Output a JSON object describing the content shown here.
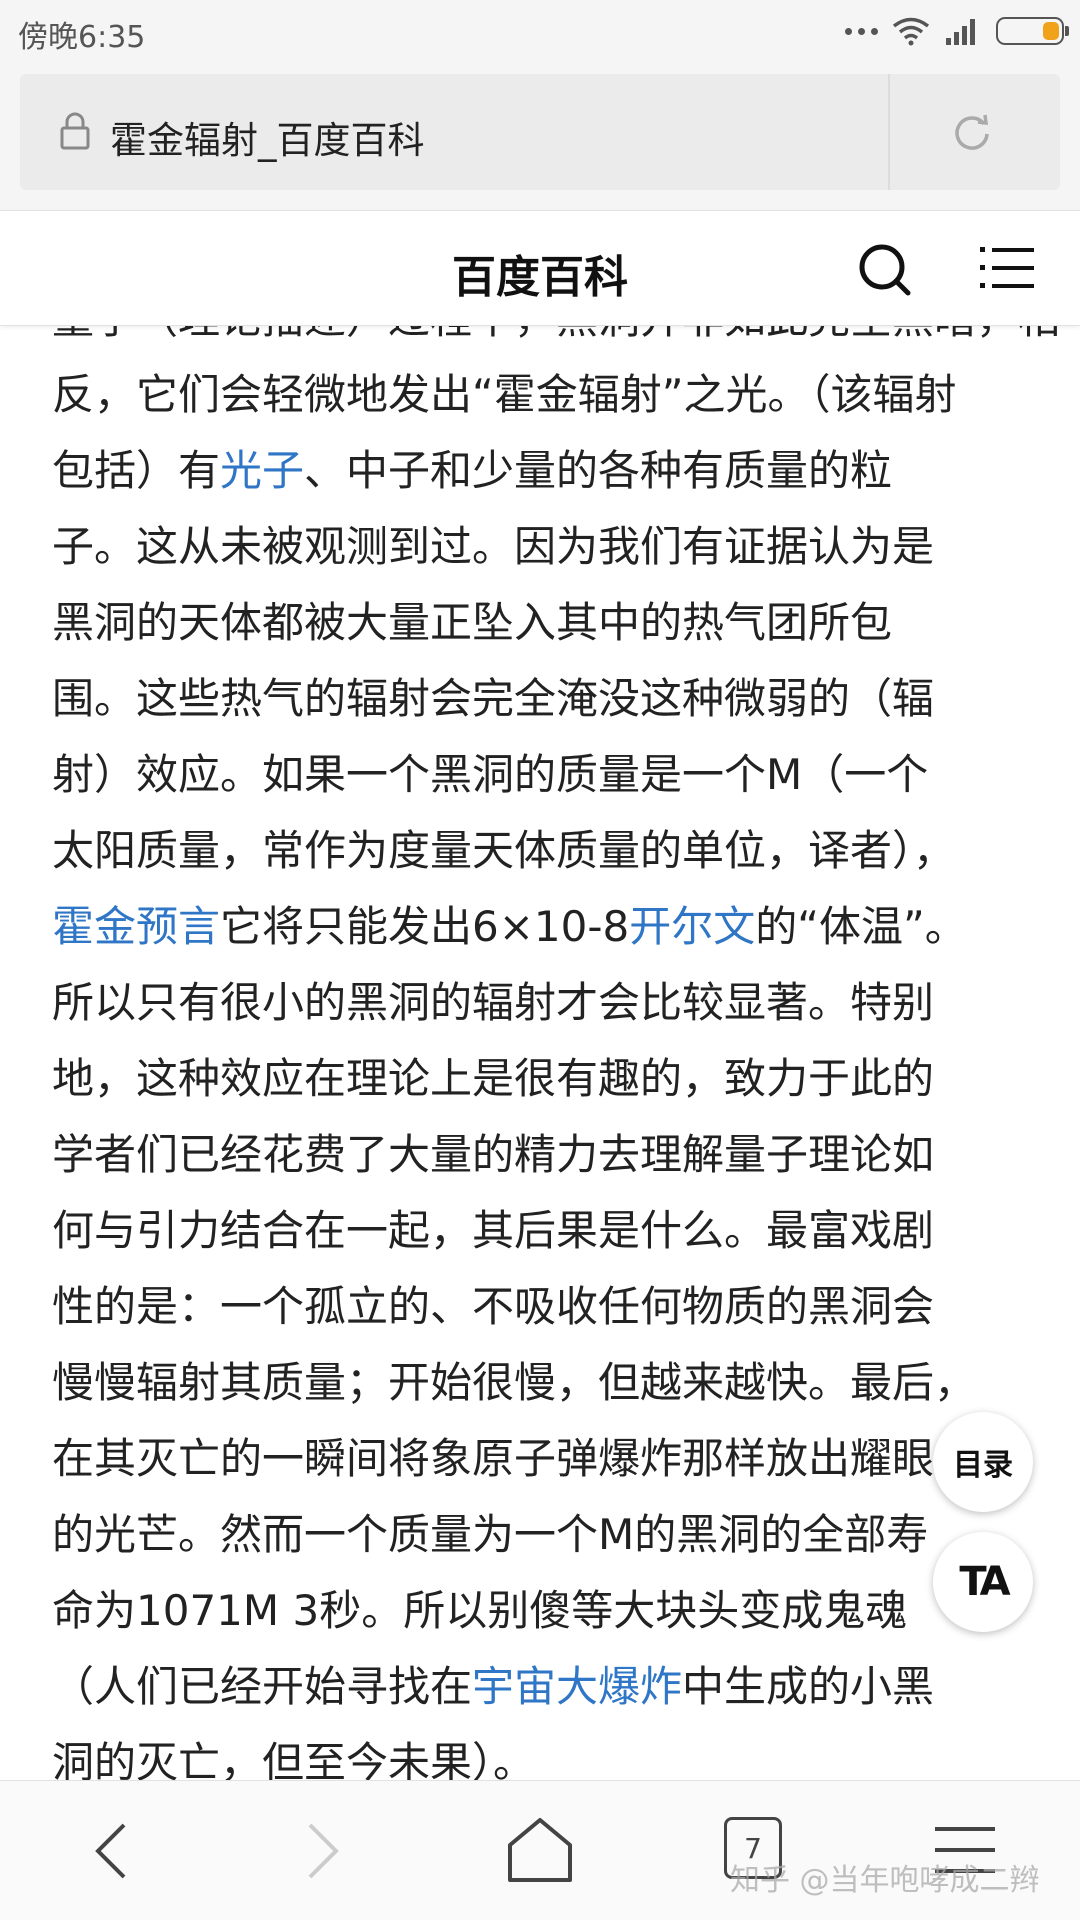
{
  "status_bar": {
    "time": "傍晚6:35",
    "battery_color": "#f0a21b"
  },
  "url_bar": {
    "title": "霍金辐射_百度百科",
    "lock_icon": "lock-icon",
    "reload_icon": "reload-icon"
  },
  "header": {
    "title": "百度百科",
    "search_icon": "search-icon",
    "menu_icon": "menu-icon"
  },
  "article": {
    "link_color": "#2f76c6",
    "lines": [
      [
        {
          "t": "量子（理论描述）过程中，黑洞并非如此完全黑暗，相"
        }
      ],
      [
        {
          "t": "反，它们会轻微地发出“霍金辐射”之光。（该辐射"
        }
      ],
      [
        {
          "t": "包括）有"
        },
        {
          "t": "光子",
          "link": true
        },
        {
          "t": "、中子和少量的各种有质量的粒"
        }
      ],
      [
        {
          "t": "子。这从未被观测到过。因为我们有证据认为是"
        }
      ],
      [
        {
          "t": "黑洞的天体都被大量正坠入其中的热气团所包"
        }
      ],
      [
        {
          "t": "围。这些热气的辐射会完全淹没这种微弱的（辐"
        }
      ],
      [
        {
          "t": "射）效应。如果一个黑洞的质量是一个M（一个"
        }
      ],
      [
        {
          "t": "太阳质量，常作为度量天体质量的单位，译者），"
        }
      ],
      [
        {
          "t": "霍金预言",
          "link": true
        },
        {
          "t": "它将只能发出6×10-8"
        },
        {
          "t": "开尔文",
          "link": true
        },
        {
          "t": "的“体温”。"
        }
      ],
      [
        {
          "t": "所以只有很小的黑洞的辐射才会比较显著。特别"
        }
      ],
      [
        {
          "t": "地，这种效应在理论上是很有趣的，致力于此的"
        }
      ],
      [
        {
          "t": "学者们已经花费了大量的精力去理解量子理论如"
        }
      ],
      [
        {
          "t": "何与引力结合在一起，其后果是什么。最富戏剧"
        }
      ],
      [
        {
          "t": "性的是：一个孤立的、不吸收任何物质的黑洞会"
        }
      ],
      [
        {
          "t": "慢慢辐射其质量；开始很慢，但越来越快。最后，"
        }
      ],
      [
        {
          "t": "在其灭亡的一瞬间将象原子弹爆炸那样放出耀眼"
        }
      ],
      [
        {
          "t": "的光芒。然而一个质量为一个M的黑洞的全部寿"
        }
      ],
      [
        {
          "t": "命为1071M 3秒。所以别傻等大块头变成鬼魂"
        }
      ],
      [
        {
          "t": "（人们已经开始寻找在"
        },
        {
          "t": "宇宙大爆炸",
          "link": true
        },
        {
          "t": "中生成的小黑"
        }
      ],
      [
        {
          "t": "洞的灭亡，但至今未果）。"
        }
      ]
    ]
  },
  "floating": {
    "toc_label": "目录",
    "font_label": "TA"
  },
  "bottom_bar": {
    "tabs_count": "7",
    "watermark": "知乎 @当年咆哮成二辫"
  }
}
